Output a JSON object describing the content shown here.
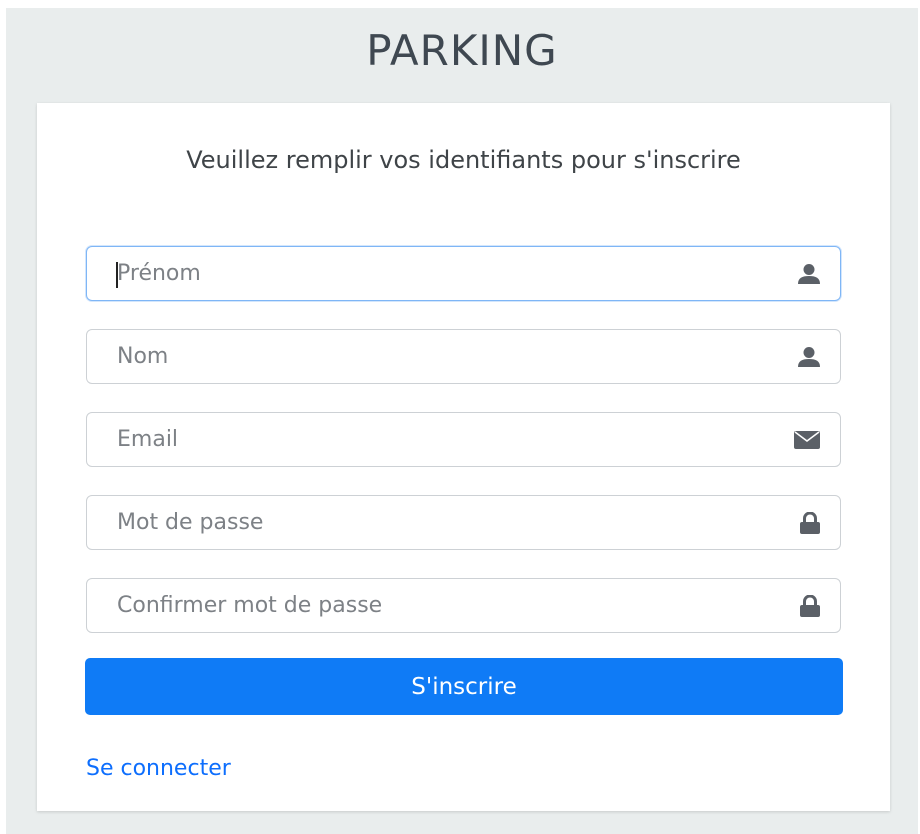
{
  "app": {
    "title": "PARKING"
  },
  "form": {
    "subtitle": "Veuillez remplir vos identifiants pour s'inscrire",
    "fields": [
      {
        "placeholder": "Prénom",
        "value": "",
        "icon": "user-icon"
      },
      {
        "placeholder": "Nom",
        "value": "",
        "icon": "user-icon"
      },
      {
        "placeholder": "Email",
        "value": "",
        "icon": "envelope-icon"
      },
      {
        "placeholder": "Mot de passe",
        "value": "",
        "icon": "lock-icon"
      },
      {
        "placeholder": "Confirmer mot de passe",
        "value": "",
        "icon": "lock-icon"
      }
    ],
    "submit_label": "S'inscrire",
    "login_link": "Se connecter"
  },
  "colors": {
    "primary": "#0f7bf6",
    "link": "#0d6efd",
    "background": "#e9eded",
    "icon": "#5b6067"
  }
}
